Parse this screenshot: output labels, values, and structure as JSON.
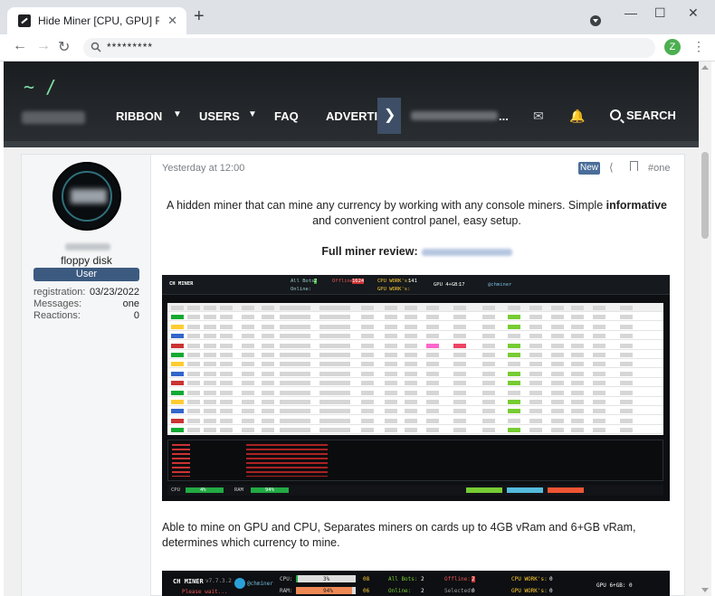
{
  "browser": {
    "tab_title": "Hide Miner [CPU, GPU] RAT, Clipp",
    "tab_close": "✕",
    "new_tab": "+",
    "address": "*********",
    "profile_initial": "Z",
    "minimize": "—",
    "maximize": "☐",
    "close": "✕"
  },
  "site": {
    "logo": "~ /",
    "nav": {
      "ribbon": "RIBBON",
      "users": "USERS",
      "faq": "FAQ",
      "advertise": "ADVERTIS",
      "user_suffix": "...",
      "search": "SEARCH"
    }
  },
  "author": {
    "title": "floppy disk",
    "badge": "User",
    "stats": [
      {
        "label": "registration:",
        "value": "03/23/2022"
      },
      {
        "label": "Messages:",
        "value": "one"
      },
      {
        "label": "Reactions:",
        "value": "0"
      }
    ]
  },
  "post": {
    "date": "Yesterday at 12:00",
    "badge": "New",
    "number": "#one",
    "intro_pre": "A hidden miner that can mine any currency by working with any console miners. Simple ",
    "intro_bold": "informative",
    "intro_post": " and convenient control panel, easy setup.",
    "review_label": "Full miner review:",
    "features": "Able to mine on GPU and CPU, Separates miners on cards up to 4GB vRam and 6+GB vRam, determines which currency to mine."
  },
  "screenshot": {
    "app_name": "CH MINER",
    "all_bots_label": "All Bots:",
    "all_bots": "2",
    "offline_label": "Offline:",
    "offline": "1624",
    "online_label": "Online:",
    "cpu_work_label": "CPU WORK's:",
    "cpu_work": "141",
    "gpu_work_label": "GPU WORK's:",
    "gpu_label": "GPU 4+GB:",
    "gpu_value": "17",
    "handle": "@chminer",
    "cpu_status": "CPU",
    "ram_status": "RAM",
    "cpu_pct": "4%",
    "ram_pct": "94%"
  },
  "screenshot2": {
    "app_name": "CH MINER",
    "version": "v7.7.3.2",
    "wait": "Please wait...",
    "handle": "@chminer",
    "cpu_label": "CPU:",
    "cpu_pct": "3%",
    "ram_label": "RAM:",
    "ram_pct": "94%",
    "cpu_count": "08",
    "ram_count": "06",
    "all_bots_label": "All Bots:",
    "all_bots": "2",
    "online_label": "Online:",
    "online": "2",
    "offline_label": "Offline:",
    "offline": "2",
    "selected_label": "Selected:",
    "selected": "0",
    "cpu_work_label": "CPU WORK's:",
    "cpu_work": "0",
    "gpu_work_label": "GPU WORK's:",
    "gpu_work": "0",
    "gpu_label": "GPU 6+GB:",
    "gpu_value": "0"
  },
  "colors": {
    "header_bg": "#1a1d20",
    "accent": "#3c5a80",
    "logo": "#7fe0a6"
  }
}
